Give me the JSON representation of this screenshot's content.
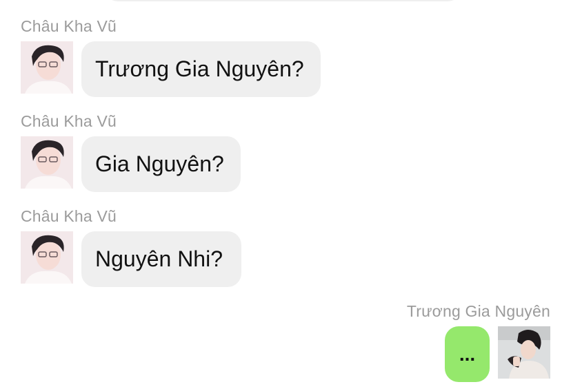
{
  "messages": [
    {
      "sender": "Châu Kha Vũ",
      "text": "Trương Gia Nguyên?",
      "avatar_icon": "user-avatar-icon"
    },
    {
      "sender": "Châu Kha Vũ",
      "text": "Gia Nguyên?",
      "avatar_icon": "user-avatar-icon"
    },
    {
      "sender": "Châu Kha Vũ",
      "text": "Nguyên Nhi?",
      "avatar_icon": "user-avatar-icon"
    },
    {
      "sender": "Trương Gia Nguyên",
      "text": "...",
      "avatar_icon": "user-avatar-icon"
    }
  ],
  "colors": {
    "incoming_bubble": "#efefef",
    "outgoing_bubble": "#95e86c",
    "sender_name": "#9b9b9b",
    "message_text": "#111111"
  }
}
